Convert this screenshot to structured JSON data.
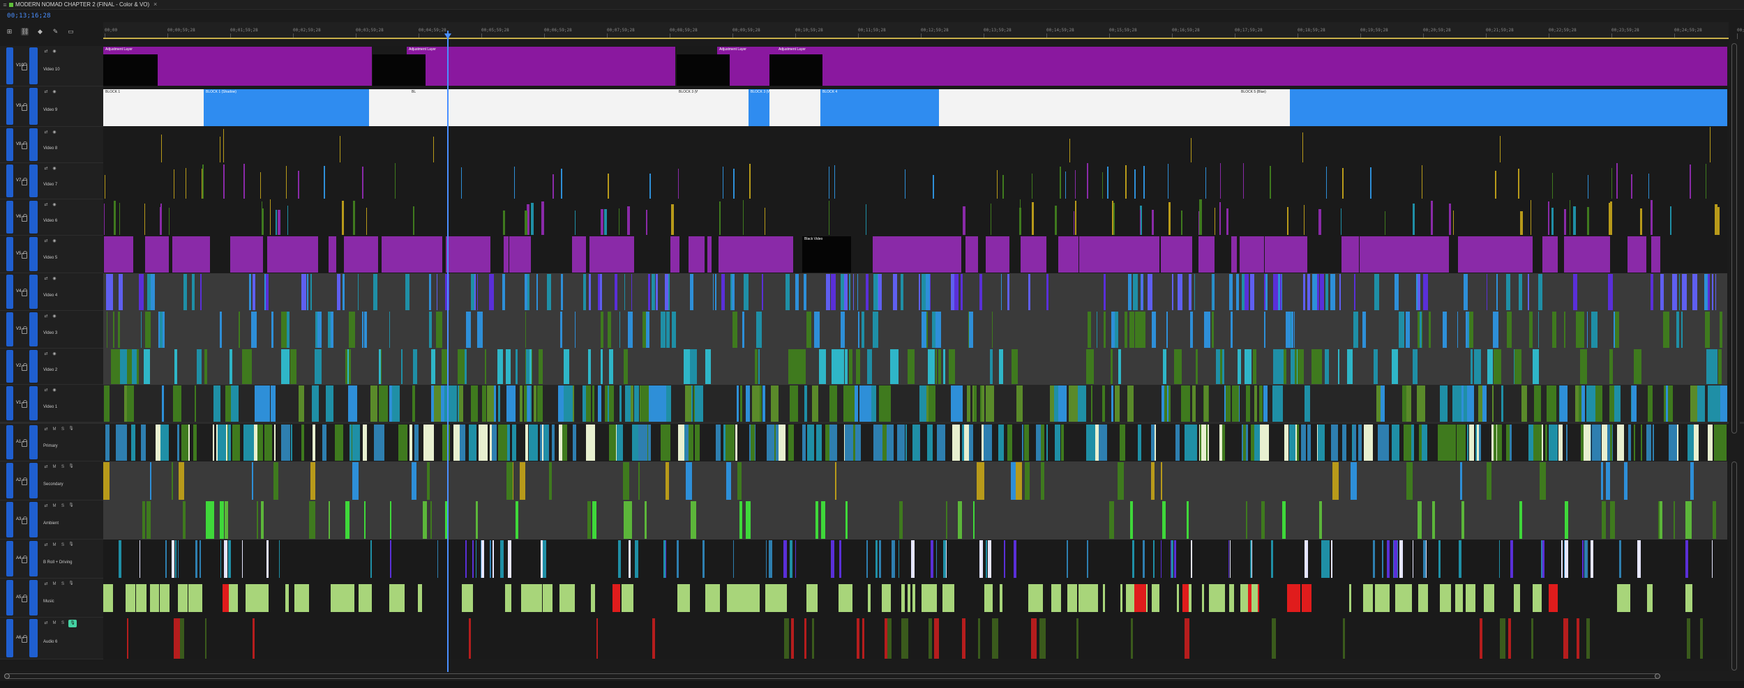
{
  "window": {
    "tab_title": "MODERN NOMAD CHAPTER 2 (FINAL - Color & VO)",
    "close_glyph": "×",
    "menu_glyph": "≡"
  },
  "timecode": "00;13;16;28",
  "toolbar": {
    "tools": [
      {
        "name": "snap-icon",
        "glyph": "⊞"
      },
      {
        "name": "linked-selection-icon",
        "glyph": "⛓"
      },
      {
        "name": "add-marker-icon",
        "glyph": "◆"
      },
      {
        "name": "wrench-icon",
        "glyph": "✎"
      },
      {
        "name": "captions-icon",
        "glyph": "▭"
      }
    ]
  },
  "ruler": {
    "labels": [
      "00;00",
      "00;00;59;28",
      "00;01;59;28",
      "00;02;59;28",
      "00;03;59;28",
      "00;04;59;28",
      "00;05;59;28",
      "00;06;59;28",
      "00;07;59;28",
      "00;08;59;28",
      "00;09;59;28",
      "00;10;59;28",
      "00;11;59;28",
      "00;12;59;28",
      "00;13;59;28",
      "00;14;59;28",
      "00;15;59;28",
      "00;16;59;28",
      "00;17;59;28",
      "00;18;59;28",
      "00;19;59;28",
      "00;20;59;28",
      "00;21;59;28",
      "00;22;59;28",
      "00;23;59;28",
      "00;24;59;28",
      "00;25;59;28",
      "00;26;59;28"
    ]
  },
  "tracks": [
    {
      "id": "V10",
      "name": "Video 10",
      "kind": "video",
      "row_style": "#1a1a1a",
      "labels": [
        "Adjustment Layer",
        "Adjustment Layer",
        "Adjustment Layer",
        "Adjustment Layer"
      ]
    },
    {
      "id": "V9",
      "name": "Video 9",
      "kind": "video",
      "row_style": "#1a1a1a",
      "labels": [
        "BLOCK 1",
        "BLOCK 1 (Shadow)",
        "BL",
        "BLOCK 3 (White)",
        "BLOCK 3 (White)",
        "BLOCK 4",
        "BLOCK 5 (Blue)",
        "BLOCK 6 (Shadow)",
        "BLOCK 7 (Blue)"
      ]
    },
    {
      "id": "V8",
      "name": "Video 8",
      "kind": "video",
      "row_style": "#1a1a1a",
      "labels": []
    },
    {
      "id": "V7",
      "name": "Video 7",
      "kind": "video",
      "row_style": "#1a1a1a",
      "labels": []
    },
    {
      "id": "V6",
      "name": "Video 6",
      "kind": "video",
      "row_style": "#1a1a1a",
      "labels": []
    },
    {
      "id": "V5",
      "name": "Video 5",
      "kind": "video",
      "row_style": "#1a1a1a",
      "labels": [
        "Black Video"
      ]
    },
    {
      "id": "V4",
      "name": "Video 4",
      "kind": "video",
      "row_style": "#3a3a3a",
      "labels": []
    },
    {
      "id": "V3",
      "name": "Video 3",
      "kind": "video",
      "row_style": "#3a3a3a",
      "labels": []
    },
    {
      "id": "V2",
      "name": "Video 2",
      "kind": "video",
      "row_style": "#3a3a3a",
      "labels": []
    },
    {
      "id": "V1",
      "name": "Video 1",
      "kind": "video",
      "row_style": "#262626",
      "labels": []
    },
    {
      "id": "A1",
      "name": "Primary",
      "kind": "audio",
      "row_style": "#1e1e1e",
      "labels": []
    },
    {
      "id": "A2",
      "name": "Secondary",
      "kind": "audio",
      "row_style": "#3a3a3a",
      "labels": []
    },
    {
      "id": "A3",
      "name": "Ambient",
      "kind": "audio",
      "row_style": "#3a3a3a",
      "labels": []
    },
    {
      "id": "A4",
      "name": "B Roll + Driving",
      "kind": "audio",
      "row_style": "#1a1a1a",
      "labels": []
    },
    {
      "id": "A5",
      "name": "Music",
      "kind": "audio",
      "row_style": "#1a1a1a",
      "labels": []
    },
    {
      "id": "A6",
      "name": "Audio 6",
      "kind": "audio",
      "row_style": "#1a1a1a",
      "labels": []
    }
  ],
  "colors": {
    "adjustment": "#8a189f",
    "black": "#050505",
    "block_blue": "#2f8cf0",
    "block_white": "#f3f3f3",
    "gold": "#b89a1a",
    "purple": "#8a2aa8",
    "music_green": "#a8d57a",
    "music_red": "#e01c1c",
    "audio_red": "#b51d1d",
    "blue": "#2e8fd8",
    "teal": "#1f8fa6",
    "lime": "#3fd83a",
    "dark_green": "#3f7a1e",
    "violet": "#5a2fd8",
    "target_blue": "#1f5fd0"
  }
}
